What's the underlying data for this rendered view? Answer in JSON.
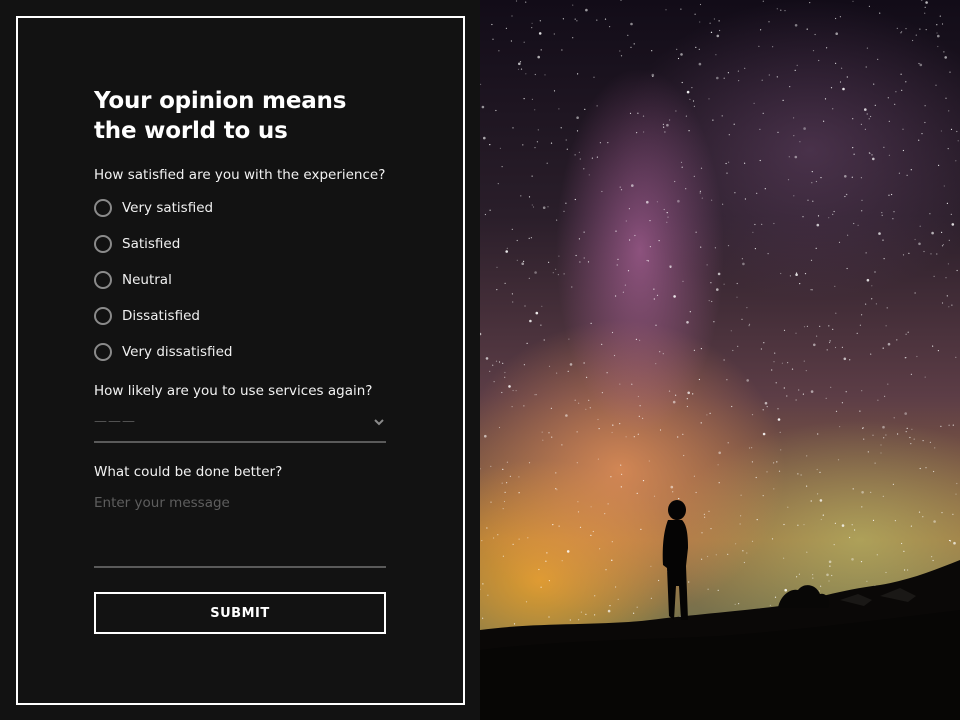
{
  "form": {
    "title_line1": "Your opinion means",
    "title_line2": "the world to us",
    "q1_label": "How satisfied are you with the experience?",
    "q1_options": [
      "Very satisfied",
      "Satisfied",
      "Neutral",
      "Dissatisfied",
      "Very dissatisfied"
    ],
    "q2_label": "How likely are you to use services again?",
    "q2_value": "———",
    "q3_label": "What could be done better?",
    "q3_placeholder": "Enter your message",
    "submit_label": "SUBMIT"
  },
  "icons": {
    "radio": "radio-unchecked-icon",
    "dropdown": "chevron-down-icon"
  },
  "colors": {
    "background": "#121212",
    "accent": "#ffffff",
    "muted": "#5e5e5e"
  }
}
